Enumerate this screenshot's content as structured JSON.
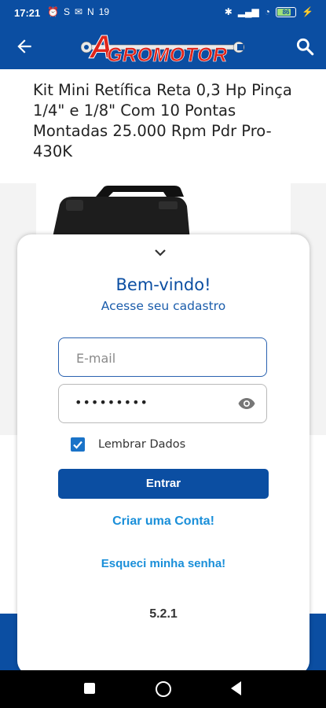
{
  "status_bar": {
    "time": "17:21",
    "left_icons": [
      "alarm-icon",
      "s-icon",
      "mail-icon",
      "n-icon",
      "19-icon"
    ],
    "battery": "86",
    "right_icons": [
      "bluetooth-icon",
      "signal-icon",
      "wifi-icon",
      "battery-icon",
      "charging-icon"
    ]
  },
  "app_bar": {
    "logo_text": "GROMOTOR",
    "logo_letter": "A",
    "brand_color": "#0b4ea2",
    "logo_color": "#e0251b"
  },
  "product": {
    "title": "Kit Mini Retífica Reta 0,3 Hp Pinça 1/4\" e 1/8\" Com 10 Pontas Montadas 25.000 Rpm Pdr Pro-430K"
  },
  "login_sheet": {
    "welcome": "Bem-vindo!",
    "subtitle": "Acesse seu cadastro",
    "email_placeholder": "E-mail",
    "password_mask": "•••••••••",
    "remember_label": "Lembrar Dados",
    "remember_checked": true,
    "enter_button": "Entrar",
    "create_account": "Criar uma Conta!",
    "forgot_password": "Esqueci minha senha!",
    "version": "5.2.1",
    "accent_color": "#1a8fd9"
  }
}
